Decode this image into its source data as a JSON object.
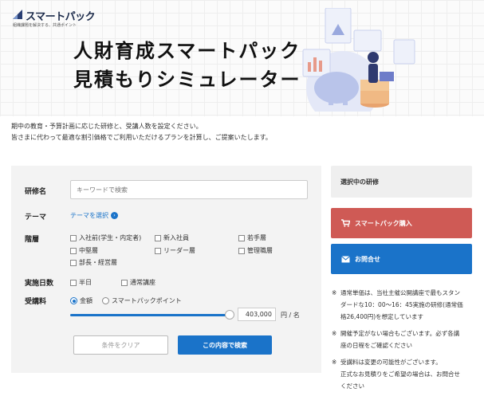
{
  "logo": {
    "brand": "スマートパック",
    "tagline": "組織課題を解決する、共通ポイント"
  },
  "hero": {
    "title_line1": "人財育成スマートパック",
    "title_line2": "見積もりシミュレーター"
  },
  "intro": {
    "line1": "期中の教育・予算計画に応じた研修と、受講人数を設定ください。",
    "line2": "皆さまに代わって最適な割引価格でご利用いただけるプランを計算し、ご提案いたします。"
  },
  "form": {
    "course_name_label": "研修名",
    "keyword_placeholder": "キーワードで検索",
    "theme_label": "テーマ",
    "theme_link": "テーマを選択",
    "level_label": "階層",
    "levels": [
      "入社前(学生・内定者)",
      "新入社員",
      "若手層",
      "中堅層",
      "リーダー層",
      "管理職層",
      "部長・経営層"
    ],
    "days_label": "実施日数",
    "days": [
      "半日",
      "通常講座"
    ],
    "fee_label": "受講料",
    "fee_options": [
      "金額",
      "スマートパックポイント"
    ],
    "fee_selected": "金額",
    "slider_level_pct": 97,
    "price_value": "403,000",
    "price_unit": "円 / 名",
    "clear_label": "条件をクリア",
    "search_label": "この内容で検索"
  },
  "sidebar": {
    "selected_label": "選択中の研修",
    "buy_label": "スマートパック購入",
    "contact_label": "お問合せ",
    "notes": [
      {
        "mark": "※",
        "lines": [
          "通常単価は、当社主催公開講座で最もスタン",
          "ダードな10：00～16：45実施の研修(通常価",
          "格26,400円)を想定しています"
        ]
      },
      {
        "mark": "※",
        "lines": [
          "開催予定がない場合もございます。必ず各講",
          "座の日程をご確認ください"
        ]
      },
      {
        "mark": "※",
        "lines": [
          "受講料は変更の可能性がございます。",
          "正式なお見積りをご希望の場合は、お問合せ",
          "ください"
        ]
      }
    ]
  },
  "colors": {
    "primary": "#1a73c9",
    "buy": "#cf5a55",
    "panel": "#f3f3f3"
  },
  "icons": {
    "cart": "cart-icon",
    "mail": "mail-icon",
    "chevron": "chevron-right-icon"
  }
}
